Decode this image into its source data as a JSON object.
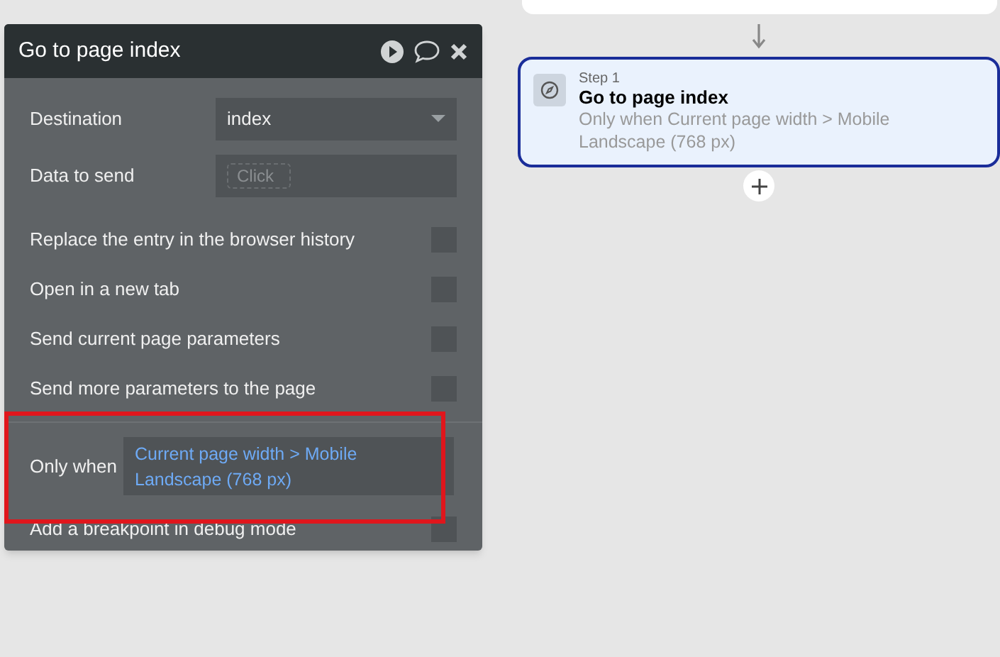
{
  "panel": {
    "title": "Go to page index",
    "destination": {
      "label": "Destination",
      "value": "index"
    },
    "data_to_send": {
      "label": "Data to send",
      "placeholder": "Click"
    },
    "options": [
      {
        "label": "Replace the entry in the browser history",
        "checked": false
      },
      {
        "label": "Open in a new tab",
        "checked": false
      },
      {
        "label": "Send current page parameters",
        "checked": false
      },
      {
        "label": "Send more parameters to the page",
        "checked": false
      }
    ],
    "only_when": {
      "label": "Only when",
      "value": "Current page width > Mobile Landscape (768 px)",
      "highlighted": true
    },
    "breakpoint": {
      "label": "Add a breakpoint in debug mode",
      "checked": false
    }
  },
  "workflow": {
    "step": {
      "step_label": "Step 1",
      "title": "Go to page index",
      "condition": "Only when Current page width > Mobile Landscape (768 px)",
      "selected": true
    }
  }
}
